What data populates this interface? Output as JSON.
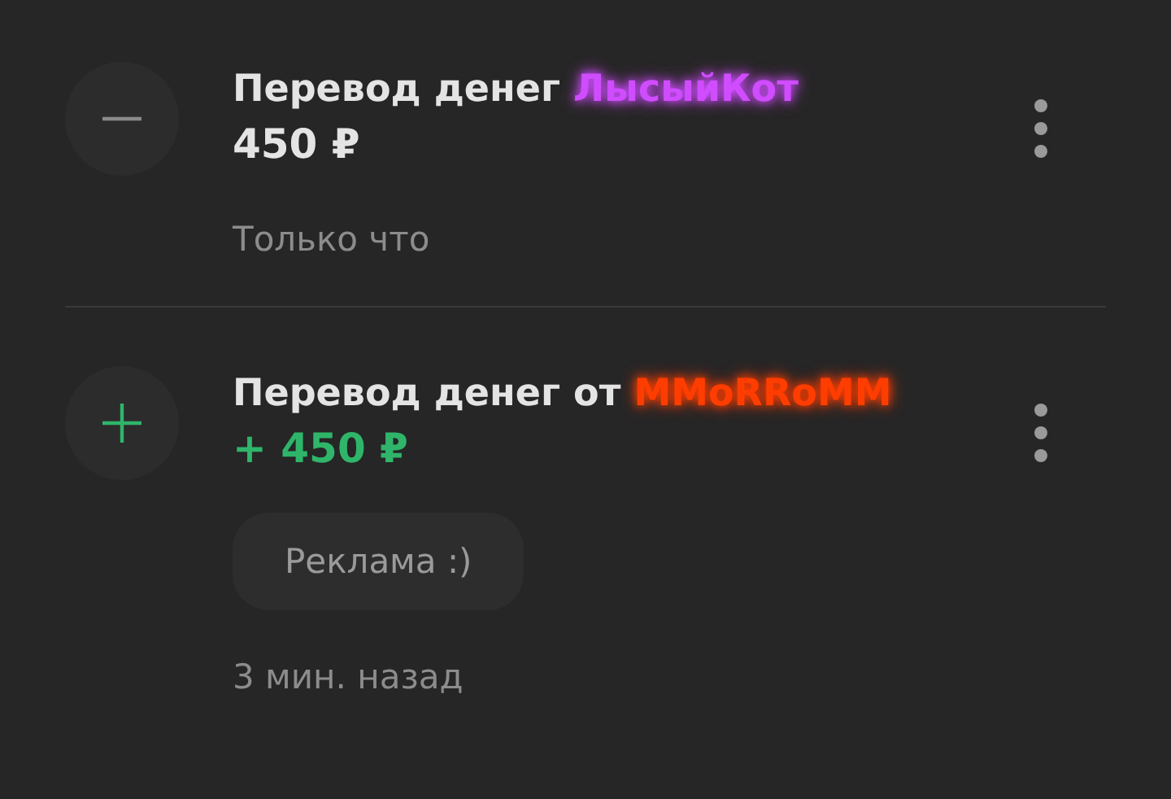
{
  "transactions": [
    {
      "kind": "outgoing",
      "title": "Перевод денег",
      "name": "ЛысыйКот",
      "color": "#d04cff",
      "amount": "450 ₽",
      "time": "Только что"
    },
    {
      "kind": "incoming",
      "title": "Перевод денег от",
      "name": "MMoRRoMM",
      "color": "#ff3d00",
      "amount": "+ 450 ₽",
      "comment": "Реклама :)",
      "time": "3 мин. назад"
    }
  ]
}
